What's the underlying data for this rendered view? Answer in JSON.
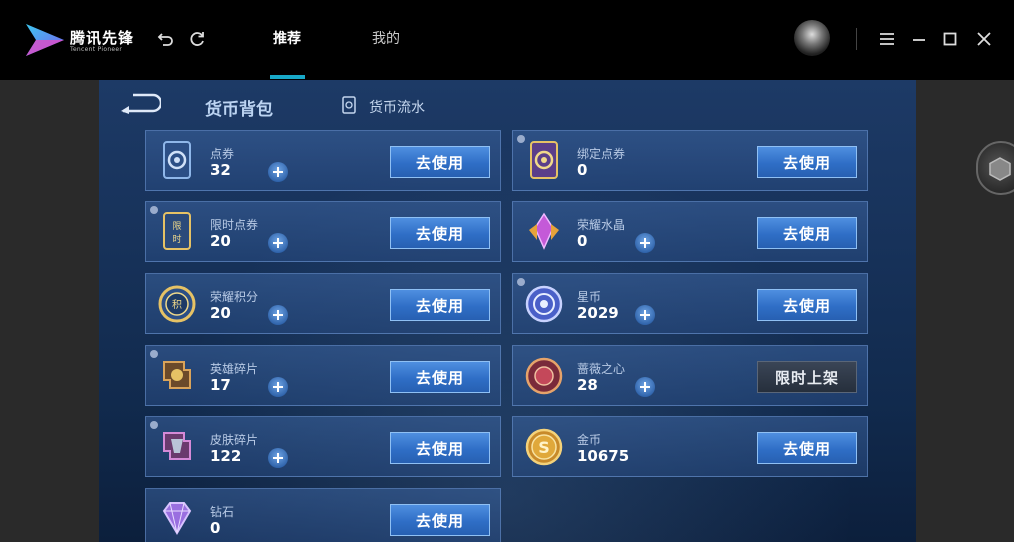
{
  "app": {
    "brand_name": "腾讯先锋",
    "brand_sub": "Tencent Pioneer",
    "nav": [
      {
        "label": "推荐",
        "active": true
      },
      {
        "label": "我的",
        "active": false
      }
    ]
  },
  "panel": {
    "title": "货币背包",
    "flow_label": "货币流水"
  },
  "cards": [
    {
      "name": "点券",
      "value": "32",
      "has_plus": true,
      "button": "去使用",
      "icon": "voucher-card-icon"
    },
    {
      "name": "绑定点券",
      "value": "0",
      "has_plus": false,
      "button": "去使用",
      "icon": "bound-voucher-icon"
    },
    {
      "name": "限时点券",
      "value": "20",
      "has_plus": true,
      "button": "去使用",
      "icon": "limited-voucher-icon"
    },
    {
      "name": "荣耀水晶",
      "value": "0",
      "has_plus": true,
      "button": "去使用",
      "icon": "glory-crystal-icon"
    },
    {
      "name": "荣耀积分",
      "value": "20",
      "has_plus": true,
      "button": "去使用",
      "icon": "glory-points-icon"
    },
    {
      "name": "星币",
      "value": "2029",
      "has_plus": true,
      "button": "去使用",
      "icon": "star-coin-icon"
    },
    {
      "name": "英雄碎片",
      "value": "17",
      "has_plus": true,
      "button": "去使用",
      "icon": "hero-shard-icon"
    },
    {
      "name": "蔷薇之心",
      "value": "28",
      "has_plus": true,
      "button": "限时上架",
      "icon": "rose-heart-icon"
    },
    {
      "name": "皮肤碎片",
      "value": "122",
      "has_plus": true,
      "button": "去使用",
      "icon": "skin-shard-icon"
    },
    {
      "name": "金币",
      "value": "10675",
      "has_plus": false,
      "button": "去使用",
      "icon": "gold-coin-icon"
    },
    {
      "name": "钻石",
      "value": "0",
      "has_plus": false,
      "button": "去使用",
      "icon": "diamond-icon"
    }
  ],
  "colors": {
    "accent": "#18a8c8",
    "button_blue": "#2f6ec6",
    "panel_bg": "#17325a"
  }
}
